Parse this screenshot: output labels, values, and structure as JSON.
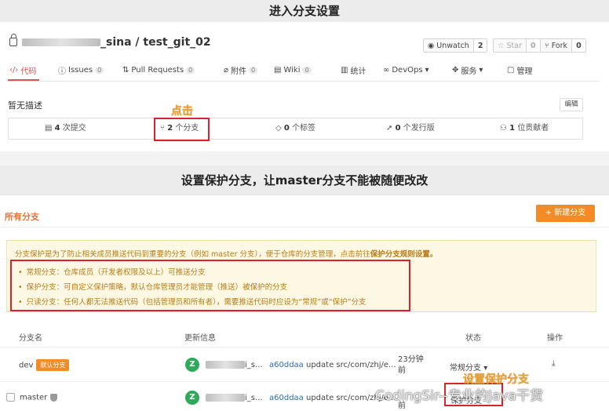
{
  "banners": {
    "top": "进入分支设置",
    "mid": "设置保护分支，让master分支不能被随便改改"
  },
  "repo": {
    "name_suffix": "_sina / test_git_02",
    "unwatch": "Unwatch",
    "unwatch_count": "2",
    "star": "Star",
    "star_count": "0",
    "fork": "Fork",
    "fork_count": "0"
  },
  "tabs": [
    {
      "label": "代码"
    },
    {
      "label": "Issues",
      "count": "0"
    },
    {
      "label": "Pull Requests",
      "count": "0"
    },
    {
      "label": "附件",
      "count": "0"
    },
    {
      "label": "Wiki",
      "count": "0"
    },
    {
      "label": "统计"
    },
    {
      "label": "DevOps"
    },
    {
      "label": "服务"
    },
    {
      "label": "管理"
    }
  ],
  "description": {
    "text": "暂无描述",
    "edit": "编辑"
  },
  "stats": {
    "commits_num": "4",
    "commits": "次提交",
    "branches_num": "2",
    "branches": "个分支",
    "tags_num": "0",
    "tags": "个标签",
    "releases_num": "0",
    "releases": "个发行版",
    "contributors_num": "1",
    "contributors": "位贡献者"
  },
  "annotations": {
    "click": "点击",
    "set_protected": "设置保护分支"
  },
  "branches_section": {
    "title": "所有分支",
    "new_button": "+ 新建分支",
    "notice_line": "分支保护是为了防止相关成员推送代码到重要的分支（例如 master 分支），便于仓库的分支管理，点击前往",
    "notice_link": "保护分支规则设置。",
    "rules": [
      "常规分支：仓库成员（开发者权限及以上）可推送分支",
      "保护分支：可自定义保护策略，默认仓库管理员才能管理（推送）被保护的分支",
      "只读分支：任何人都无法推送代码（包括管理员和所有者），需要推送代码时应设为“常规”或“保护”分支"
    ],
    "headers": {
      "name": "分支名",
      "update": "更新信息",
      "status": "状态",
      "ops": "操作"
    },
    "rows": [
      {
        "name": "dev",
        "default_tag": "默认分支",
        "avatar": "Z",
        "user_suffix": "i_s...",
        "hash": "a60ddaa",
        "message": "update src/com/zhj/e...",
        "time_a": "23分钟",
        "time_b": "前",
        "status": "常规分支"
      },
      {
        "name": "master",
        "avatar": "Z",
        "user_suffix": "i_s...",
        "hash": "a60ddaa",
        "message": "update src/com/zhj/e...",
        "time_b": "前",
        "status": "保护分支"
      }
    ]
  },
  "watermark": "CodingSir--专业的Java干货"
}
